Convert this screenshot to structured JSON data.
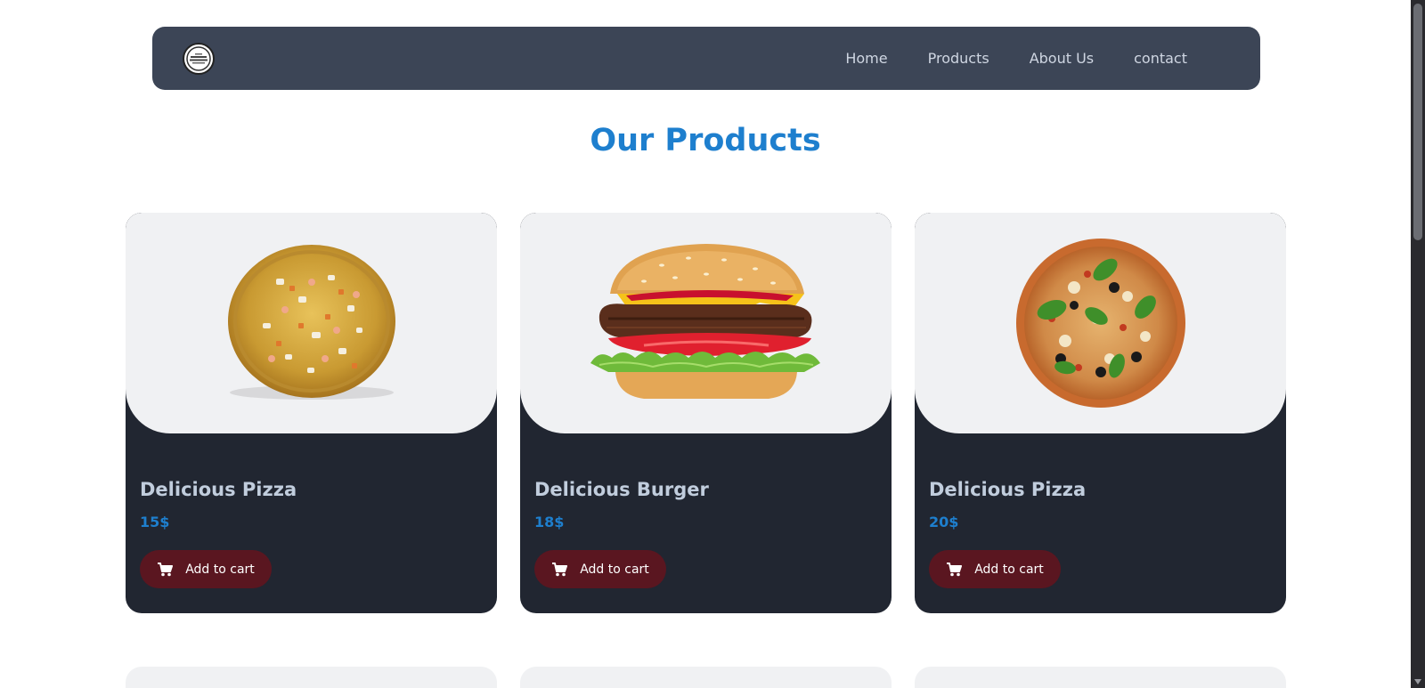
{
  "nav": {
    "links": [
      "Home",
      "Products",
      "About Us",
      "contact"
    ]
  },
  "products_section": {
    "title": "Our Products",
    "cards": [
      {
        "name": "Delicious Pizza",
        "price": "15$",
        "image": "pizza-seafood",
        "button_label": "Add to cart"
      },
      {
        "name": "Delicious Burger",
        "price": "18$",
        "image": "burger",
        "button_label": "Add to cart"
      },
      {
        "name": "Delicious Pizza",
        "price": "20$",
        "image": "pizza-basil",
        "button_label": "Add to cart"
      }
    ]
  },
  "icons": {
    "cart": "cart-icon",
    "logo": "logo-icon"
  },
  "colors": {
    "navbar_bg": "#3c4556",
    "title": "#1e7fce",
    "card_bg": "#212631",
    "card_image_bg": "#f0f1f3",
    "price": "#1e7fce",
    "button_bg": "#5a1620"
  }
}
